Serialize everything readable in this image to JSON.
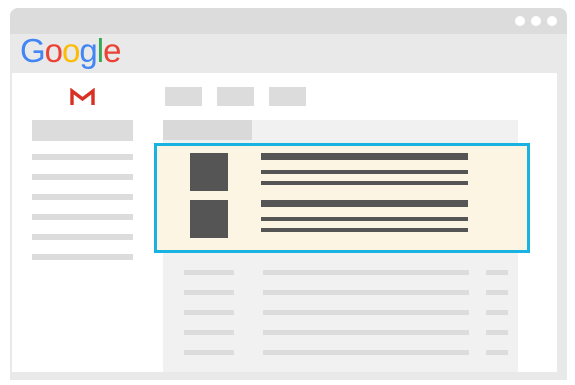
{
  "browser": {
    "window_dots": [
      "dot-1",
      "dot-2",
      "dot-3"
    ]
  },
  "header": {
    "logo_letters": [
      {
        "ch": "G",
        "color": "#4285F4"
      },
      {
        "ch": "o",
        "color": "#EA4335"
      },
      {
        "ch": "o",
        "color": "#FBBC05"
      },
      {
        "ch": "g",
        "color": "#4285F4"
      },
      {
        "ch": "l",
        "color": "#34A853"
      },
      {
        "ch": "e",
        "color": "#EA4335"
      }
    ]
  },
  "gmail": {
    "icon": "gmail-m-icon",
    "icon_color": "#D93025"
  },
  "toolbar": {
    "buttons": [
      "toolbar-button-1",
      "toolbar-button-2",
      "toolbar-button-3"
    ]
  },
  "highlight": {
    "border_color": "#1AB2E0",
    "background": "#FDF5E4",
    "emails": [
      "highlighted-email-1",
      "highlighted-email-2"
    ]
  },
  "colors": {
    "placeholder": "#DCDCDC",
    "dark_placeholder": "#555555"
  }
}
